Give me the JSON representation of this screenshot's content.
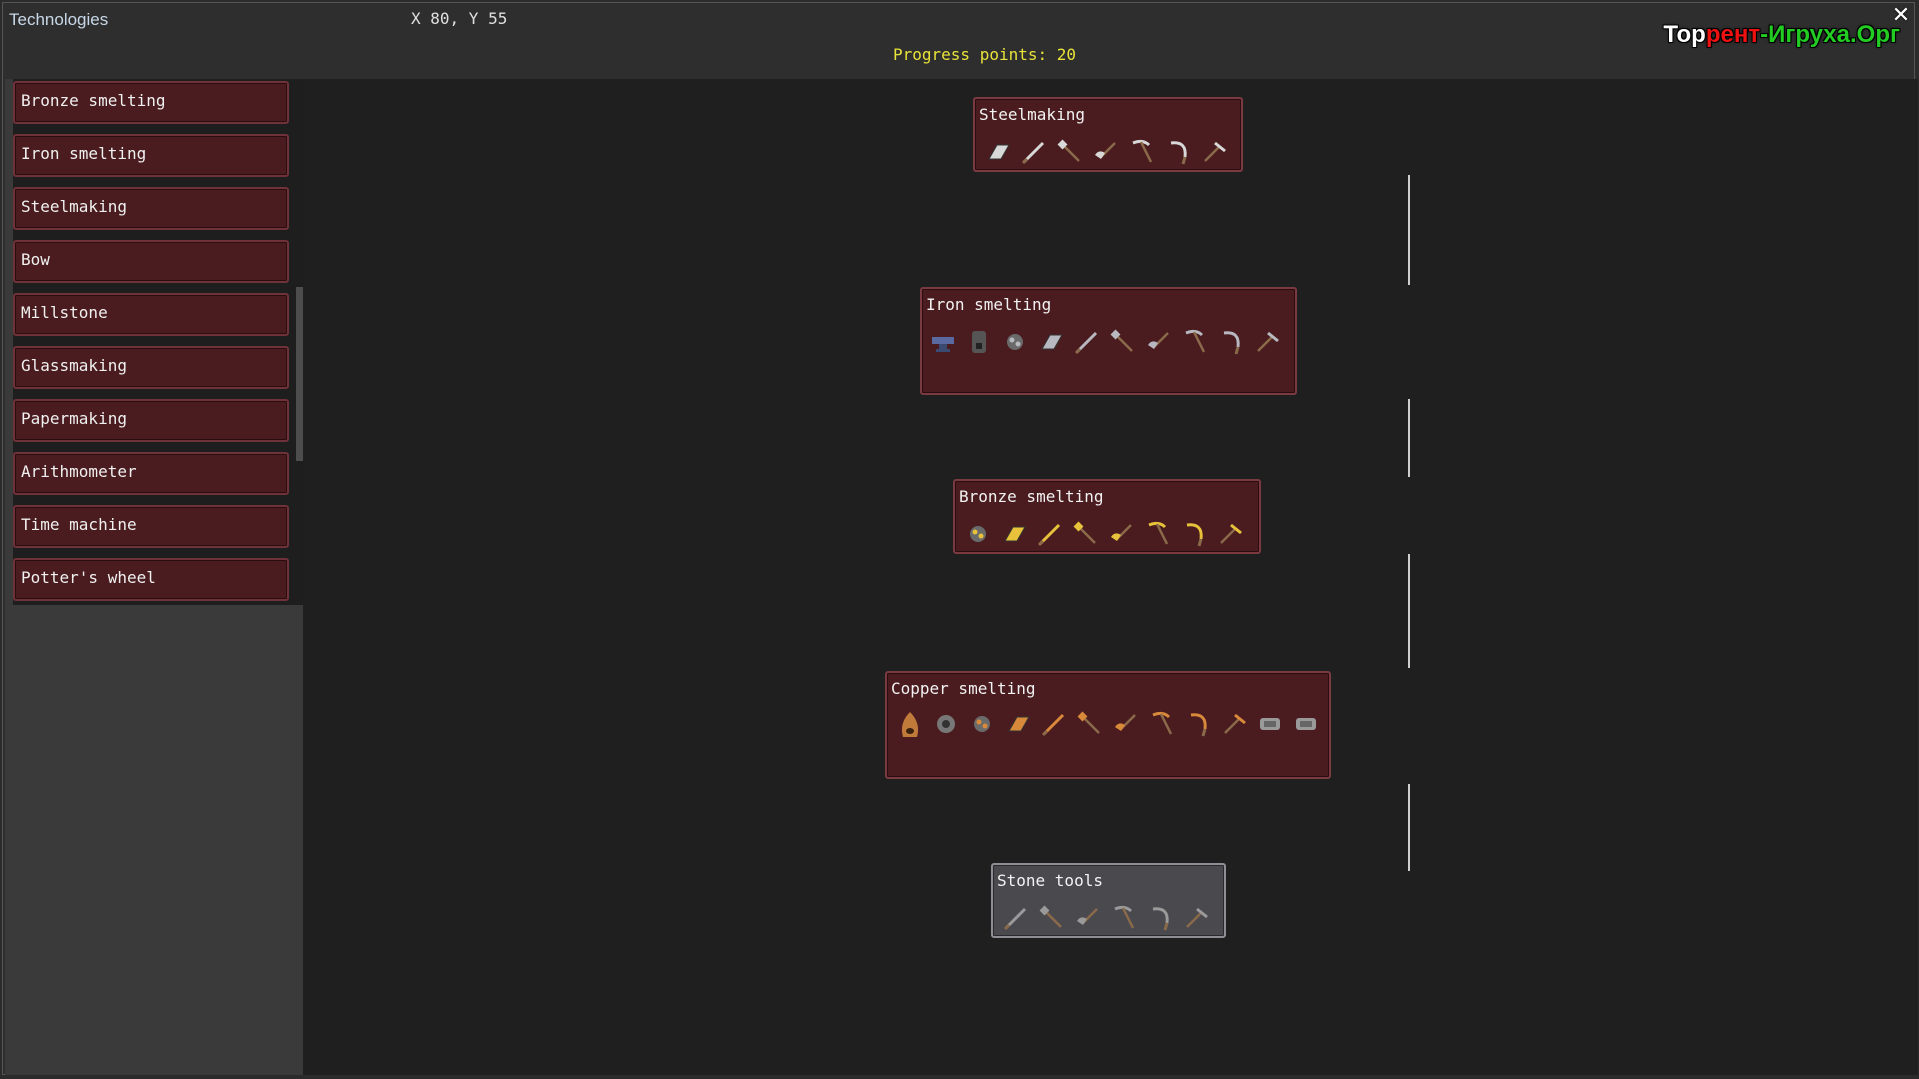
{
  "window": {
    "title": "Technologies",
    "coords": "X 80, Y 55",
    "progress": "Progress points: 20",
    "watermark": {
      "part1": "Тор",
      "part2": "рент",
      "part3": "-Игруха",
      "part4": ".Орг"
    }
  },
  "sidebar": {
    "items": [
      {
        "label": "Bronze smelting"
      },
      {
        "label": "Iron smelting"
      },
      {
        "label": "Steelmaking"
      },
      {
        "label": "Bow"
      },
      {
        "label": "Millstone"
      },
      {
        "label": "Glassmaking"
      },
      {
        "label": "Papermaking"
      },
      {
        "label": "Arithmometer"
      },
      {
        "label": "Time machine"
      },
      {
        "label": "Potter's wheel"
      }
    ]
  },
  "tree": {
    "nodes": [
      {
        "title": "Steelmaking",
        "state": "locked",
        "icons": [
          "ingot-icon",
          "sword-icon",
          "shovel-icon",
          "axe-icon",
          "pickaxe-icon",
          "sickle-icon",
          "hoe-icon"
        ]
      },
      {
        "title": "Iron smelting",
        "state": "locked",
        "icons": [
          "anvil-icon",
          "furnace-icon",
          "ore-icon",
          "ingot-icon",
          "sword-icon",
          "shovel-icon",
          "axe-icon",
          "pickaxe-icon",
          "sickle-icon",
          "hoe-icon"
        ]
      },
      {
        "title": "Bronze smelting",
        "state": "locked",
        "icons": [
          "ore-icon",
          "ingot-icon",
          "sword-icon",
          "shovel-icon",
          "axe-icon",
          "pickaxe-icon",
          "sickle-icon",
          "hoe-icon"
        ]
      },
      {
        "title": "Copper smelting",
        "state": "locked",
        "icons": [
          "kiln-icon",
          "bellows-icon",
          "ore-icon",
          "ingot-icon",
          "sword-icon",
          "shovel-icon",
          "axe-icon",
          "pickaxe-icon",
          "sickle-icon",
          "hoe-icon",
          "mold-icon",
          "mold-icon"
        ]
      },
      {
        "title": "Stone tools",
        "state": "unlocked",
        "icons": [
          "sword-icon",
          "shovel-icon",
          "axe-icon",
          "pickaxe-icon",
          "sickle-icon",
          "hoe-icon"
        ]
      }
    ]
  },
  "colors": {
    "locked_card": "#4a1c1f",
    "unlocked_card": "#4a4a4e",
    "progress_text": "#e8e23a",
    "copper": "#d9893a",
    "iron": "#c8c8c8",
    "bronze": "#e8c23a"
  }
}
